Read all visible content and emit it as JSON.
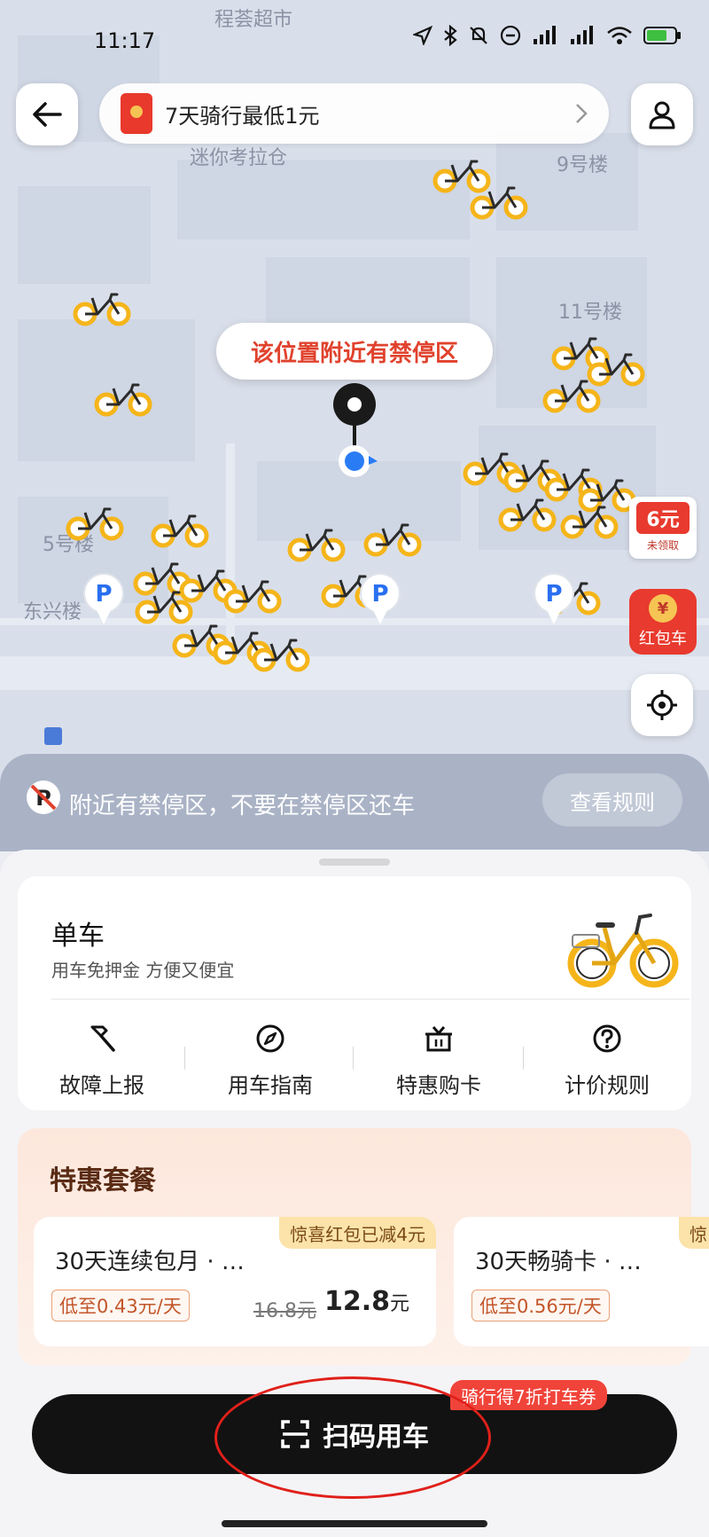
{
  "status_bar": {
    "time": "11:17"
  },
  "top": {
    "promo_text": "7天骑行最低1元"
  },
  "map": {
    "labels": {
      "supermarket": "程荟超市",
      "warehouse": "迷你考拉仓",
      "b9": "9号楼",
      "b11": "11号楼",
      "b5": "5号楼",
      "dongxing": "东兴楼"
    },
    "warning": "该位置附近有禁停区",
    "coupon_amount": "6元",
    "coupon_sub": "未领取",
    "redpacket_label": "红包车"
  },
  "notice": {
    "text": "附近有禁停区，不要在禁停区还车",
    "button": "查看规则"
  },
  "bike_card": {
    "title": "单车",
    "subtitle": "用车免押金 方便又便宜",
    "services": [
      "故障上报",
      "用车指南",
      "特惠购卡",
      "计价规则"
    ]
  },
  "deals": {
    "title": "特惠套餐",
    "cards": [
      {
        "tag": "惊喜红包已减4元",
        "name": "30天连续包月 · …",
        "badge": "低至0.43元/天",
        "old_price": "16.8元",
        "price": "12.8",
        "unit": "元"
      },
      {
        "tag": "惊",
        "name": "30天畅骑卡 · …",
        "badge": "低至0.56元/天"
      }
    ]
  },
  "cta": {
    "label": "扫码用车",
    "tag": "骑行得7折打车券"
  },
  "colors": {
    "accent_red": "#e0422d",
    "bike_yellow": "#f5b51a",
    "cta_black": "#121212"
  }
}
